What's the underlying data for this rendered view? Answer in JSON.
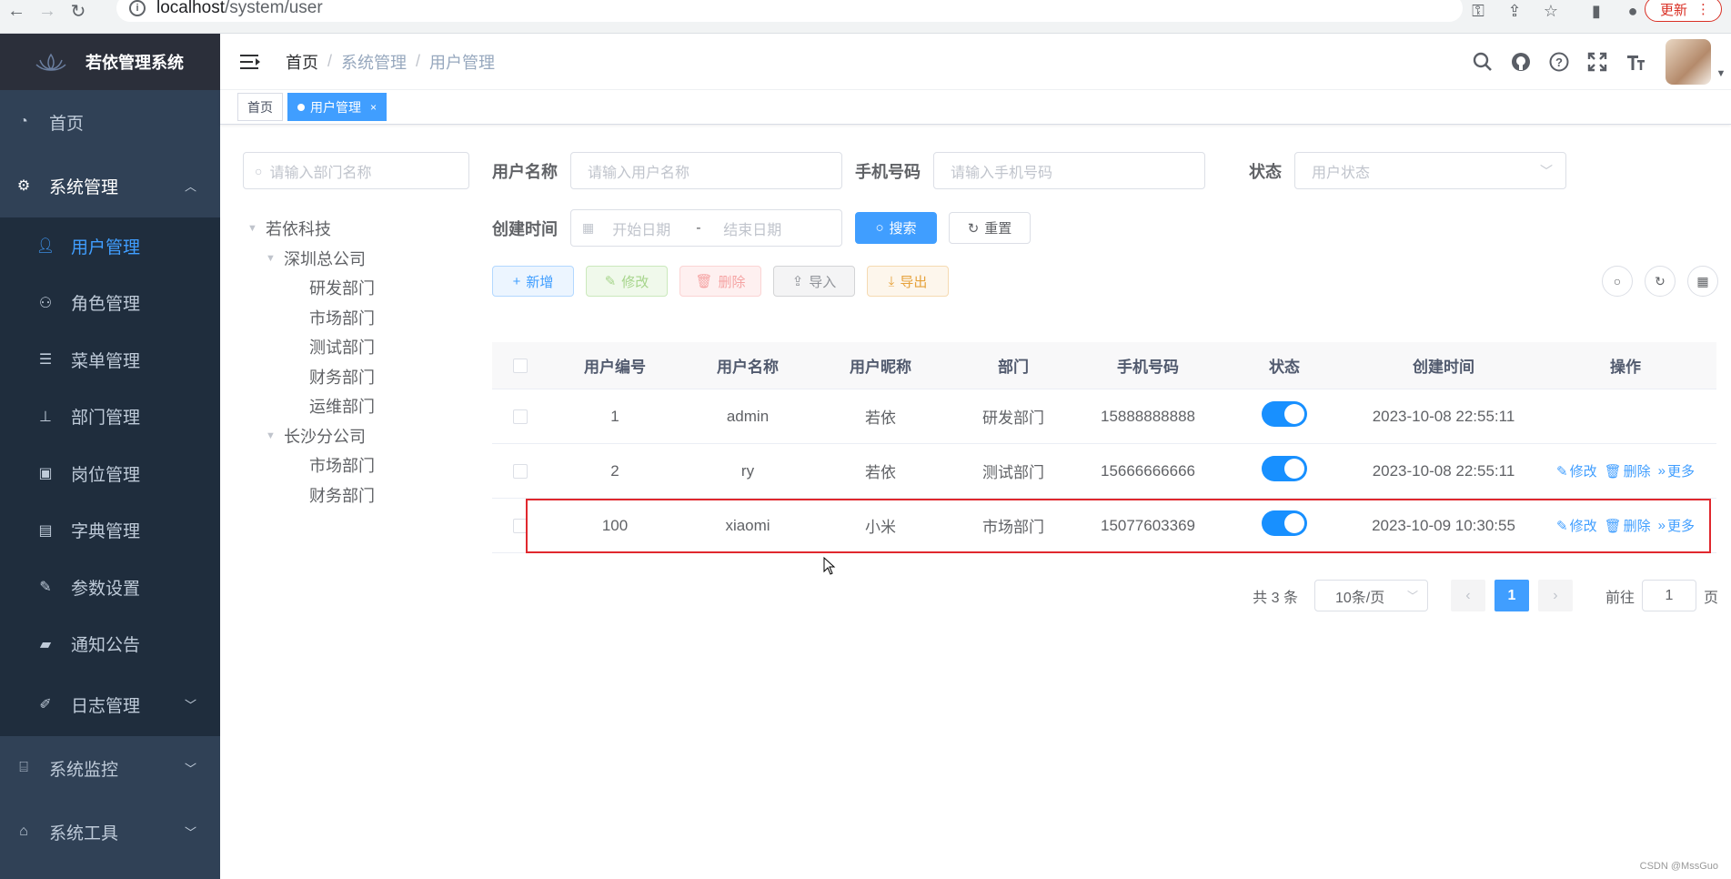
{
  "browser": {
    "url_host": "localhost",
    "url_path": "/system/user",
    "update_label": "更新"
  },
  "sidebar": {
    "title": "若依管理系统",
    "items": [
      {
        "label": "首页",
        "icon": "dashboard-icon"
      },
      {
        "label": "系统管理",
        "icon": "gear-icon"
      },
      {
        "label": "用户管理",
        "icon": "user-icon"
      },
      {
        "label": "角色管理",
        "icon": "peoples-icon"
      },
      {
        "label": "菜单管理",
        "icon": "tree-table-icon"
      },
      {
        "label": "部门管理",
        "icon": "tree-icon"
      },
      {
        "label": "岗位管理",
        "icon": "post-icon"
      },
      {
        "label": "字典管理",
        "icon": "dict-icon"
      },
      {
        "label": "参数设置",
        "icon": "edit-icon"
      },
      {
        "label": "通知公告",
        "icon": "message-icon"
      },
      {
        "label": "日志管理",
        "icon": "log-icon"
      },
      {
        "label": "系统监控",
        "icon": "monitor-icon"
      },
      {
        "label": "系统工具",
        "icon": "tool-icon"
      }
    ]
  },
  "breadcrumb": [
    "首页",
    "系统管理",
    "用户管理"
  ],
  "tags": {
    "home": "首页",
    "active": "用户管理",
    "close": "×"
  },
  "dept_tree": {
    "placeholder": "请输入部门名称",
    "nodes": [
      {
        "label": "若依科技",
        "level": 0,
        "caret": true
      },
      {
        "label": "深圳总公司",
        "level": 1,
        "caret": true
      },
      {
        "label": "研发部门",
        "level": 2
      },
      {
        "label": "市场部门",
        "level": 2
      },
      {
        "label": "测试部门",
        "level": 2
      },
      {
        "label": "财务部门",
        "level": 2
      },
      {
        "label": "运维部门",
        "level": 2
      },
      {
        "label": "长沙分公司",
        "level": 1,
        "caret": true
      },
      {
        "label": "市场部门",
        "level": 2
      },
      {
        "label": "财务部门",
        "level": 2
      }
    ]
  },
  "search_form": {
    "username_label": "用户名称",
    "username_placeholder": "请输入用户名称",
    "phone_label": "手机号码",
    "phone_placeholder": "请输入手机号码",
    "status_label": "状态",
    "status_placeholder": "用户状态",
    "time_label": "创建时间",
    "start_placeholder": "开始日期",
    "range_sep": "-",
    "end_placeholder": "结束日期",
    "search_label": "搜索",
    "reset_label": "重置"
  },
  "toolbar": {
    "add": "新增",
    "edit": "修改",
    "delete": "删除",
    "import": "导入",
    "export": "导出"
  },
  "table": {
    "headers": [
      "用户编号",
      "用户名称",
      "用户昵称",
      "部门",
      "手机号码",
      "状态",
      "创建时间",
      "操作"
    ],
    "rows": [
      {
        "id": "1",
        "name": "admin",
        "nick": "若依",
        "dept": "研发部门",
        "phone": "15888888888",
        "status": true,
        "time": "2023-10-08 22:55:11",
        "ops": []
      },
      {
        "id": "2",
        "name": "ry",
        "nick": "若依",
        "dept": "测试部门",
        "phone": "15666666666",
        "status": true,
        "time": "2023-10-08 22:55:11",
        "ops": [
          "修改",
          "删除",
          "更多"
        ]
      },
      {
        "id": "100",
        "name": "xiaomi",
        "nick": "小米",
        "dept": "市场部门",
        "phone": "15077603369",
        "status": true,
        "time": "2023-10-09 10:30:55",
        "ops": [
          "修改",
          "删除",
          "更多"
        ]
      }
    ]
  },
  "pagination": {
    "total": "共 3 条",
    "page_size": "10条/页",
    "current": "1",
    "goto_label": "前往",
    "goto_value": "1",
    "page_suffix": "页"
  },
  "watermark": "CSDN @MssGuo",
  "colors": {
    "primary": "#409eff",
    "sidebar_bg": "#304156",
    "highlight": "#e0282e"
  }
}
